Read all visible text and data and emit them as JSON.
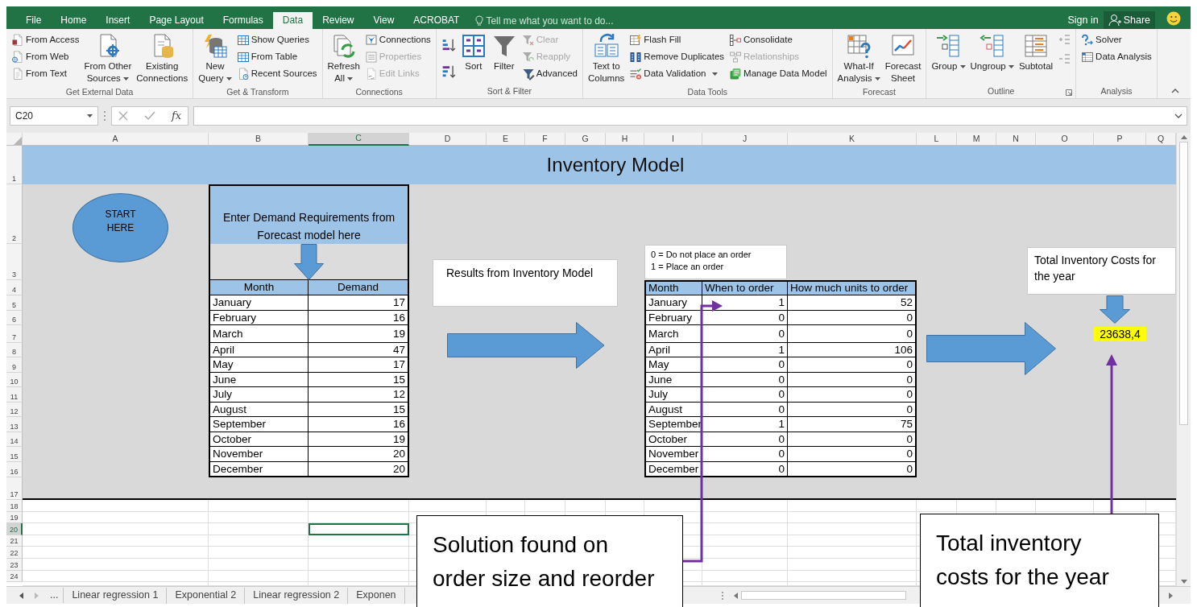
{
  "tabs": [
    {
      "label": "File",
      "selected": false
    },
    {
      "label": "Home",
      "selected": false
    },
    {
      "label": "Insert",
      "selected": false
    },
    {
      "label": "Page Layout",
      "selected": false
    },
    {
      "label": "Formulas",
      "selected": false
    },
    {
      "label": "Data",
      "selected": true
    },
    {
      "label": "Review",
      "selected": false
    },
    {
      "label": "View",
      "selected": false
    },
    {
      "label": "ACROBAT",
      "selected": false
    }
  ],
  "tell_me": {
    "placeholder": "Tell me what you want to do..."
  },
  "account": {
    "sign_in": "Sign in",
    "share": "Share"
  },
  "ribbon": {
    "groups": [
      {
        "label": "Get External Data",
        "launcher": false,
        "columns": [
          {
            "kind": "stack",
            "items": [
              {
                "label": "From Access",
                "disabled": false,
                "dropdown": false
              },
              {
                "label": "From Web",
                "disabled": false,
                "dropdown": false
              },
              {
                "label": "From Text",
                "disabled": false,
                "dropdown": false
              }
            ]
          },
          {
            "kind": "large",
            "lines": [
              "From Other",
              "Sources"
            ],
            "disabled": false,
            "dropdown": true
          },
          {
            "kind": "large",
            "lines": [
              "Existing",
              "Connections"
            ],
            "disabled": false,
            "dropdown": false
          }
        ]
      },
      {
        "label": "Get & Transform",
        "launcher": false,
        "columns": [
          {
            "kind": "large",
            "lines": [
              "New",
              "Query"
            ],
            "disabled": false,
            "dropdown": true
          },
          {
            "kind": "stack",
            "items": [
              {
                "label": "Show Queries",
                "disabled": false,
                "dropdown": false
              },
              {
                "label": "From Table",
                "disabled": false,
                "dropdown": false
              },
              {
                "label": "Recent Sources",
                "disabled": false,
                "dropdown": false
              }
            ]
          }
        ]
      },
      {
        "label": "Connections",
        "launcher": false,
        "columns": [
          {
            "kind": "large",
            "lines": [
              "Refresh",
              "All"
            ],
            "disabled": false,
            "dropdown": true
          },
          {
            "kind": "stack",
            "items": [
              {
                "label": "Connections",
                "disabled": false,
                "dropdown": false
              },
              {
                "label": "Properties",
                "disabled": true,
                "dropdown": false
              },
              {
                "label": "Edit Links",
                "disabled": true,
                "dropdown": false
              }
            ]
          }
        ]
      },
      {
        "label": "Sort & Filter",
        "launcher": false,
        "columns": [
          {
            "kind": "sort-icons"
          },
          {
            "kind": "large",
            "lines": [
              "Sort"
            ],
            "disabled": false,
            "dropdown": false
          },
          {
            "kind": "large",
            "lines": [
              "Filter"
            ],
            "disabled": false,
            "dropdown": false
          },
          {
            "kind": "stack",
            "items": [
              {
                "label": "Clear",
                "disabled": true,
                "dropdown": false
              },
              {
                "label": "Reapply",
                "disabled": true,
                "dropdown": false
              },
              {
                "label": "Advanced",
                "disabled": false,
                "dropdown": false
              }
            ]
          }
        ]
      },
      {
        "label": "Data Tools",
        "launcher": false,
        "columns": [
          {
            "kind": "large",
            "lines": [
              "Text to",
              "Columns"
            ],
            "disabled": false,
            "dropdown": false
          },
          {
            "kind": "stack",
            "items": [
              {
                "label": "Flash Fill",
                "disabled": false,
                "dropdown": false
              },
              {
                "label": "Remove Duplicates",
                "disabled": false,
                "dropdown": false
              },
              {
                "label": "Data Validation",
                "disabled": false,
                "dropdown": true
              }
            ]
          },
          {
            "kind": "stack",
            "items": [
              {
                "label": "Consolidate",
                "disabled": false,
                "dropdown": false
              },
              {
                "label": "Relationships",
                "disabled": true,
                "dropdown": false
              },
              {
                "label": "Manage Data Model",
                "disabled": false,
                "dropdown": false
              }
            ]
          }
        ]
      },
      {
        "label": "Forecast",
        "launcher": false,
        "columns": [
          {
            "kind": "large",
            "lines": [
              "What-If",
              "Analysis"
            ],
            "disabled": false,
            "dropdown": true
          },
          {
            "kind": "large",
            "lines": [
              "Forecast",
              "Sheet"
            ],
            "disabled": false,
            "dropdown": false
          }
        ]
      },
      {
        "label": "Outline",
        "launcher": true,
        "columns": [
          {
            "kind": "large",
            "lines": [
              "Group"
            ],
            "disabled": false,
            "dropdown": true
          },
          {
            "kind": "large",
            "lines": [
              "Ungroup"
            ],
            "disabled": false,
            "dropdown": true
          },
          {
            "kind": "large",
            "lines": [
              "Subtotal"
            ],
            "disabled": false,
            "dropdown": false
          },
          {
            "kind": "detail-icons"
          }
        ]
      },
      {
        "label": "Analysis",
        "launcher": false,
        "columns": [
          {
            "kind": "stack",
            "items": [
              {
                "label": "Solver",
                "disabled": false,
                "dropdown": false
              },
              {
                "label": "Data Analysis",
                "disabled": false,
                "dropdown": false
              }
            ]
          }
        ]
      }
    ]
  },
  "formula_bar": {
    "name_box": "C20",
    "function_button": "fx"
  },
  "sheet": {
    "columns": [
      {
        "label": "A",
        "selected": false
      },
      {
        "label": "B",
        "selected": false
      },
      {
        "label": "C",
        "selected": true
      },
      {
        "label": "D",
        "selected": false
      },
      {
        "label": "E",
        "selected": false
      },
      {
        "label": "F",
        "selected": false
      },
      {
        "label": "G",
        "selected": false
      },
      {
        "label": "H",
        "selected": false
      },
      {
        "label": "I",
        "selected": false
      },
      {
        "label": "J",
        "selected": false
      },
      {
        "label": "K",
        "selected": false
      },
      {
        "label": "L",
        "selected": false
      },
      {
        "label": "M",
        "selected": false
      },
      {
        "label": "N",
        "selected": false
      },
      {
        "label": "O",
        "selected": false
      },
      {
        "label": "P",
        "selected": false
      },
      {
        "label": "Q",
        "selected": false
      }
    ],
    "rows": [
      {
        "label": "1",
        "selected": false
      },
      {
        "label": "2",
        "selected": false
      },
      {
        "label": "3",
        "selected": false
      },
      {
        "label": "4",
        "selected": false
      },
      {
        "label": "5",
        "selected": false
      },
      {
        "label": "6",
        "selected": false
      },
      {
        "label": "7",
        "selected": false
      },
      {
        "label": "8",
        "selected": false
      },
      {
        "label": "9",
        "selected": false
      },
      {
        "label": "10",
        "selected": false
      },
      {
        "label": "11",
        "selected": false
      },
      {
        "label": "12",
        "selected": false
      },
      {
        "label": "13",
        "selected": false
      },
      {
        "label": "14",
        "selected": false
      },
      {
        "label": "15",
        "selected": false
      },
      {
        "label": "16",
        "selected": false
      },
      {
        "label": "17",
        "selected": false
      },
      {
        "label": "18",
        "selected": false
      },
      {
        "label": "19",
        "selected": false
      },
      {
        "label": "20",
        "selected": true
      },
      {
        "label": "21",
        "selected": false
      },
      {
        "label": "22",
        "selected": false
      },
      {
        "label": "23",
        "selected": false
      },
      {
        "label": "24",
        "selected": false
      }
    ],
    "title": "Inventory Model",
    "start_shape": [
      "START",
      "HERE"
    ],
    "demand_table": {
      "header": [
        "Enter Demand Requirements from",
        "Forecast model here"
      ],
      "columns": [
        "Month",
        "Demand"
      ],
      "rows": [
        [
          "January",
          "17"
        ],
        [
          "February",
          "16"
        ],
        [
          "March",
          "19"
        ],
        [
          "April",
          "47"
        ],
        [
          "May",
          "17"
        ],
        [
          "June",
          "15"
        ],
        [
          "July",
          "12"
        ],
        [
          "August",
          "15"
        ],
        [
          "September",
          "16"
        ],
        [
          "October",
          "19"
        ],
        [
          "November",
          "20"
        ],
        [
          "December",
          "20"
        ]
      ]
    },
    "results_box": "Results from Inventory Model",
    "legend": [
      "0 = Do not place an order",
      "1 = Place an order"
    ],
    "order_table": {
      "columns": [
        "Month",
        "When to order",
        "How much units to order"
      ],
      "rows": [
        [
          "January",
          "1",
          "52"
        ],
        [
          "February",
          "0",
          "0"
        ],
        [
          "March",
          "0",
          "0"
        ],
        [
          "April",
          "1",
          "106"
        ],
        [
          "May",
          "0",
          "0"
        ],
        [
          "June",
          "0",
          "0"
        ],
        [
          "July",
          "0",
          "0"
        ],
        [
          "August",
          "0",
          "0"
        ],
        [
          "September",
          "1",
          "75"
        ],
        [
          "October",
          "0",
          "0"
        ],
        [
          "November",
          "0",
          "0"
        ],
        [
          "December",
          "0",
          "0"
        ]
      ]
    },
    "total_label": [
      "Total Inventory Costs for",
      "the year"
    ],
    "total_value": "23638,4",
    "callouts": [
      [
        "Solution found on",
        "order size and reorder"
      ],
      [
        "Total inventory",
        "costs for the year"
      ]
    ]
  },
  "sheet_tabs": {
    "more": "...",
    "tabs": [
      {
        "label": "Linear regression 1",
        "selected": false
      },
      {
        "label": "Exponential 2",
        "selected": false
      },
      {
        "label": "Linear regression 2",
        "selected": false
      },
      {
        "label": "Exponen",
        "selected": false
      }
    ]
  }
}
